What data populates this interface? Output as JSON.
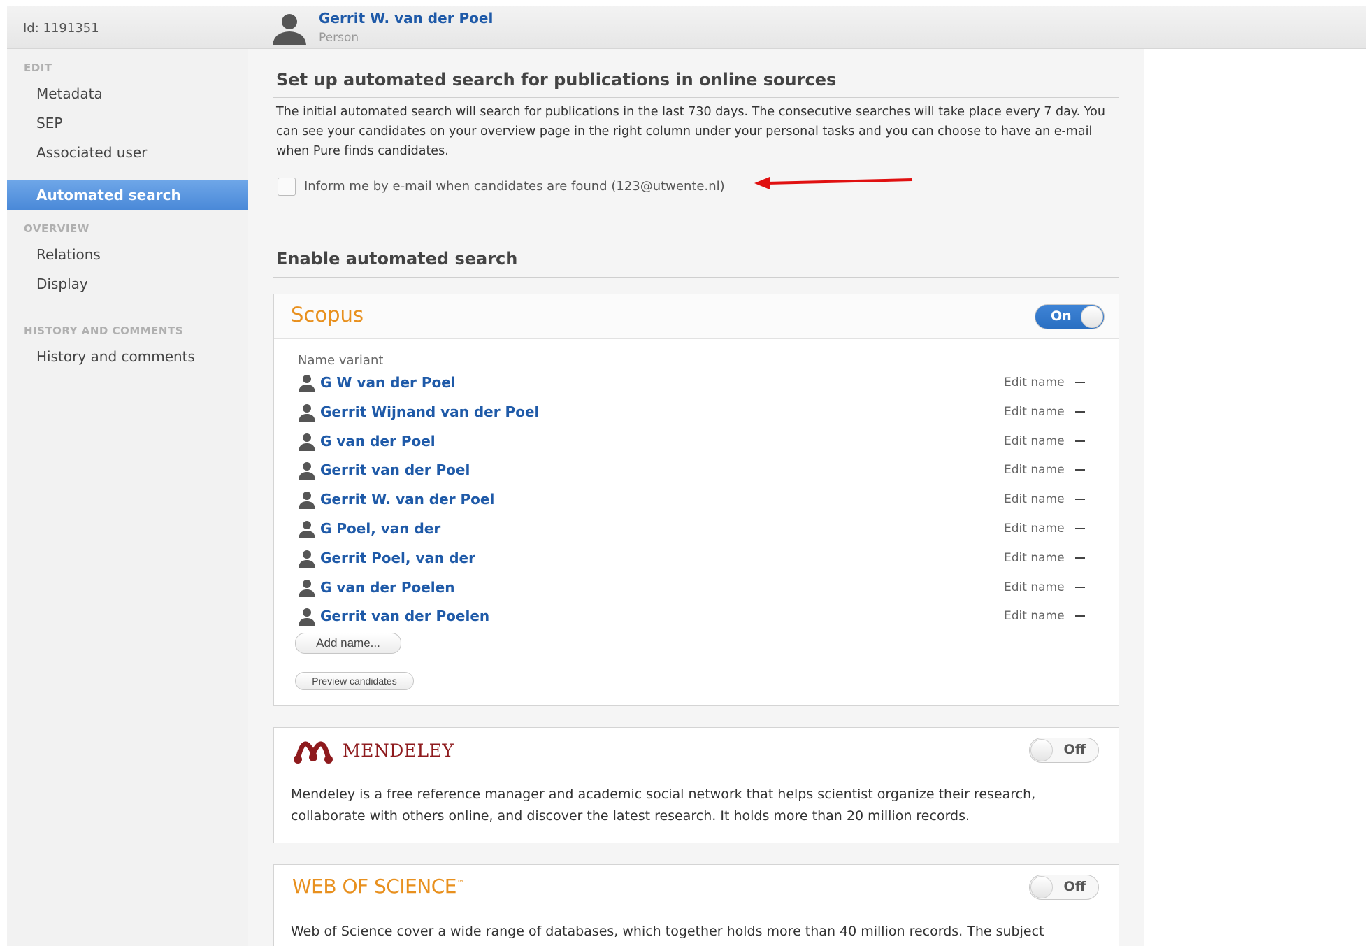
{
  "header": {
    "id_label": "Id: 1191351",
    "person_name": "Gerrit W. van der Poel",
    "person_type": "Person"
  },
  "sidebar": {
    "edit_heading": "EDIT",
    "edit_items": [
      "Metadata",
      "SEP",
      "Associated user",
      "Automated search"
    ],
    "active_item": "Automated search",
    "overview_heading": "OVERVIEW",
    "overview_items": [
      "Relations",
      "Display"
    ],
    "history_heading": "HISTORY AND COMMENTS",
    "history_items": [
      "History and comments"
    ]
  },
  "setup": {
    "title": "Set up automated search for publications in online sources",
    "description": "The initial automated search will search for publications in the last 730 days. The consecutive searches will take place every 7 day. You can see your candidates on your overview page in the right column under your personal tasks and you can choose to have an e-mail when Pure finds candidates.",
    "inform_label": "Inform me by e-mail when candidates are found (123@utwente.nl)",
    "inform_checked": false
  },
  "enable": {
    "title": "Enable automated search"
  },
  "scopus": {
    "title": "Scopus",
    "toggle_label": "On",
    "enabled": true,
    "name_variant_heading": "Name variant",
    "edit_label": "Edit name",
    "names": [
      "G W van der Poel",
      "Gerrit Wijnand van der Poel",
      "G van der Poel",
      "Gerrit van der Poel",
      "Gerrit W. van der Poel",
      "G Poel, van der",
      "Gerrit Poel, van der",
      "G van der Poelen",
      "Gerrit van der Poelen"
    ],
    "add_name_label": "Add name...",
    "preview_label": "Preview candidates"
  },
  "mendeley": {
    "title": "MENDELEY",
    "toggle_label": "Off",
    "enabled": false,
    "description": "Mendeley is a free reference manager and academic social network that helps scientist organize their research, collaborate with others online, and discover the latest research. It holds more than 20 million records."
  },
  "wos": {
    "title": "WEB OF SCIENCE",
    "trademark": "™",
    "toggle_label": "Off",
    "enabled": false,
    "description": "Web of Science cover a wide range of databases, which together holds more than 40 million records. The subject"
  },
  "colors": {
    "link_blue": "#1f5aa8",
    "accent_orange": "#e8901e",
    "active_blue": "#4a89d8",
    "mendeley_red": "#8e1a1d",
    "annotation_red": "#e01010"
  }
}
